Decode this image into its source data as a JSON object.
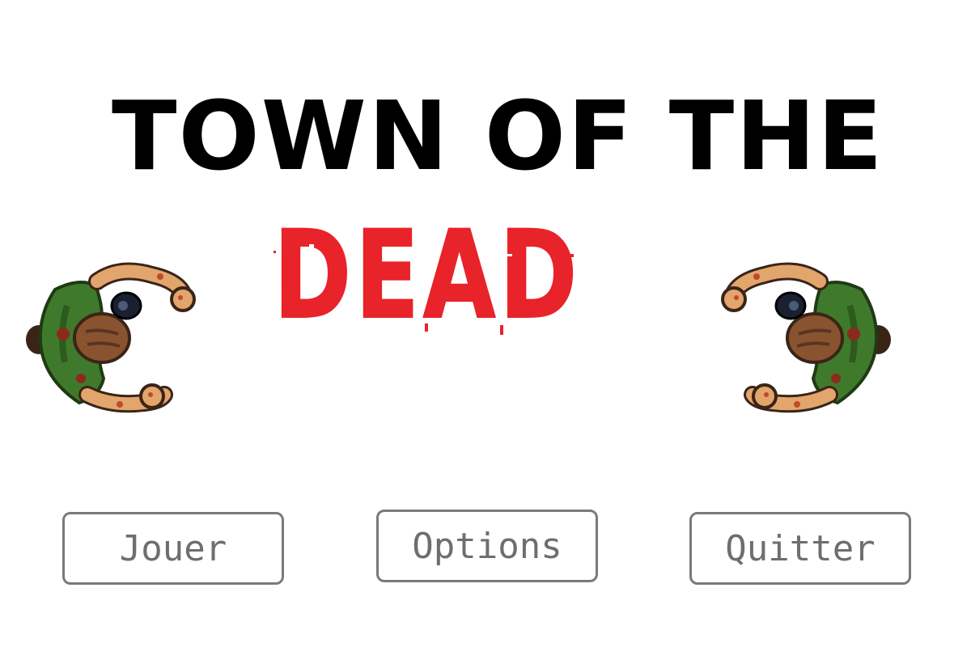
{
  "title": {
    "line1": "TOWN OF THE",
    "line2": "DEAD",
    "line1_color": "#000000",
    "line2_color": "#e8232a"
  },
  "sprites": {
    "left": "zombie-sprite",
    "right": "zombie-sprite"
  },
  "menu": {
    "play_label": "Jouer",
    "options_label": "Options",
    "quit_label": "Quitter",
    "border_color": "#7a7a7a",
    "text_color": "#6e6e6e"
  }
}
